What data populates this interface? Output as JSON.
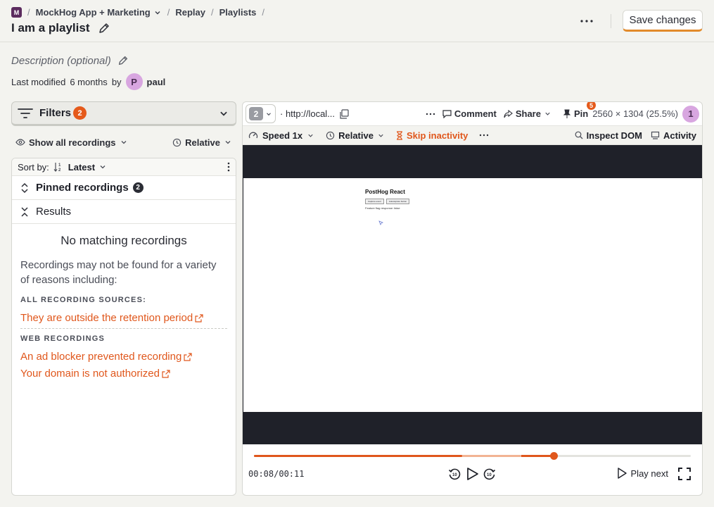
{
  "breadcrumb": {
    "project_badge": "M",
    "project": "MockHog App + Marketing",
    "replay": "Replay",
    "playlists": "Playlists"
  },
  "page": {
    "title": "I am a playlist",
    "save_label": "Save changes",
    "description_placeholder": "Description (optional)",
    "modified_prefix": "Last modified",
    "modified_time": "6 months",
    "modified_by_word": "by",
    "user_initial": "P",
    "user_name": "paul"
  },
  "filters": {
    "label": "Filters",
    "count": "2",
    "show_all": "Show all recordings",
    "relative": "Relative",
    "sort_label": "Sort by:",
    "sort_value": "Latest"
  },
  "sections": {
    "pinned_label": "Pinned recordings",
    "pinned_count": "2",
    "results_label": "Results"
  },
  "empty_state": {
    "title": "No matching recordings",
    "text": "Recordings may not be found for a variety of reasons including:",
    "all_sources_heading": "ALL RECORDING SOURCES:",
    "reason_retention": "They are outside the retention period",
    "web_heading": "WEB RECORDINGS",
    "reason_adblock": "An ad blocker prevented recording",
    "reason_domain": "Your domain is not authorized"
  },
  "player": {
    "tab_count": "2",
    "url": "· http://local...",
    "comment": "Comment",
    "share": "Share",
    "pin": "Pin",
    "pin_badge": "5",
    "resolution": "2560 × 1304 (25.5%)",
    "viewer_count": "1",
    "speed": "Speed 1x",
    "relative": "Relative",
    "skip_inactivity": "Skip inactivity",
    "inspect_dom": "Inspect DOM",
    "activity": "Activity",
    "time_current": "00:08",
    "time_sep": "/",
    "time_total": "00:11",
    "play_next": "Play next",
    "progress_fraction": 0.686,
    "buffered_fraction": 0.68,
    "seek_back_label": "10",
    "seek_forward_label": "10"
  },
  "recording_page": {
    "heading": "PostHog React",
    "button1": "Capture event",
    "button2": "Autocapture button",
    "note": "Feature flag response: false"
  },
  "colors": {
    "accent": "#e0571c",
    "badge": "#e55a1b",
    "avatar": "#d8a6e0",
    "viewport_bg": "#1f2129"
  }
}
